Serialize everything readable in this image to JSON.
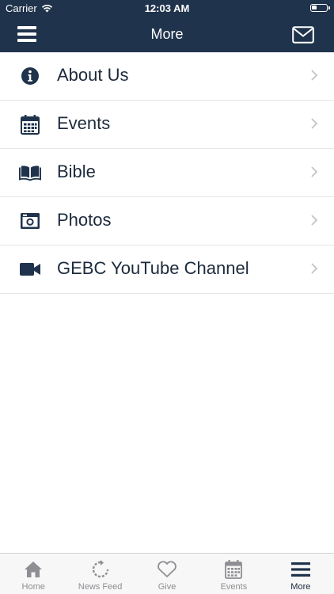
{
  "status_bar": {
    "carrier": "Carrier",
    "time": "12:03 AM"
  },
  "nav": {
    "title": "More"
  },
  "menu": {
    "items": [
      {
        "label": "About Us",
        "icon": "info-icon"
      },
      {
        "label": "Events",
        "icon": "calendar-icon"
      },
      {
        "label": "Bible",
        "icon": "bible-icon"
      },
      {
        "label": "Photos",
        "icon": "camera-icon"
      },
      {
        "label": "GEBC YouTube Channel",
        "icon": "video-camera-icon"
      }
    ]
  },
  "tab_bar": {
    "items": [
      {
        "label": "Home",
        "icon": "home-icon"
      },
      {
        "label": "News Feed",
        "icon": "refresh-icon"
      },
      {
        "label": "Give",
        "icon": "heart-icon"
      },
      {
        "label": "Events",
        "icon": "calendar-icon"
      },
      {
        "label": "More",
        "icon": "menu-icon",
        "active": true
      }
    ]
  },
  "colors": {
    "header": "#1f334c",
    "icon": "#1f334c",
    "tab_inactive": "#8e8e93",
    "tab_active": "#1c2a3c"
  }
}
